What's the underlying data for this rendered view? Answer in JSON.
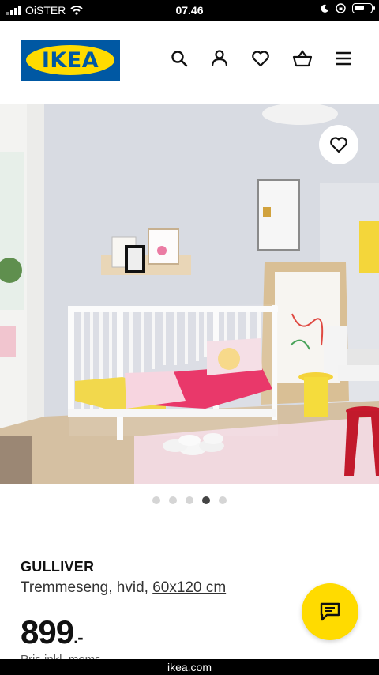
{
  "status_bar": {
    "carrier": "OiSTER",
    "time": "07.46"
  },
  "header": {
    "logo_text": "IKEA",
    "icons": [
      "search-icon",
      "user-icon",
      "heart-icon",
      "basket-icon",
      "menu-icon"
    ]
  },
  "gallery": {
    "favorite_icon": "heart-icon",
    "dots_total": 5,
    "active_index": 3
  },
  "product": {
    "name": "GULLIVER",
    "description": "Tremmeseng, hvid,",
    "size_link": "60x120 cm",
    "price": "899",
    "price_suffix": ".-",
    "price_note": "Pris inkl. moms"
  },
  "chat": {
    "icon": "chat-icon"
  },
  "footer": {
    "domain": "ikea.com"
  },
  "colors": {
    "brand_blue": "#0058A3",
    "brand_yellow": "#FFDB00"
  }
}
